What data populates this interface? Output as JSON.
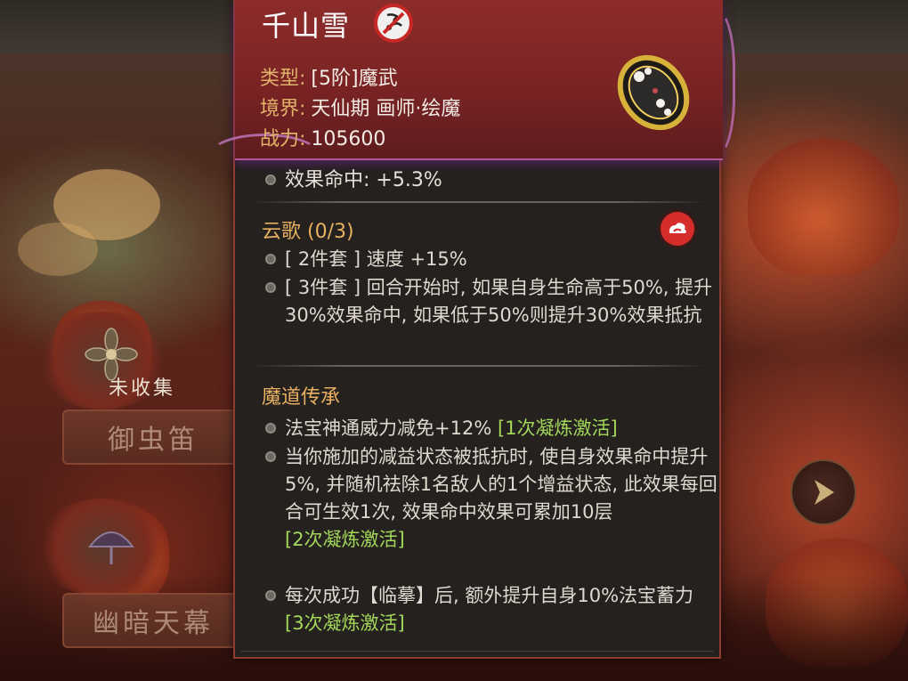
{
  "background": {
    "side_items": [
      {
        "name": "御虫笛",
        "status": "未收集"
      },
      {
        "name": "幽暗天幕",
        "status": ""
      }
    ]
  },
  "tooltip": {
    "name": "千山雪",
    "restriction_icon": "no-entry-icon",
    "type_label": "类型:",
    "type_value": "[5阶]魔武",
    "realm_label": "境界:",
    "realm_value": "天仙期 画师·绘魔",
    "power_label": "战力:",
    "power_value": "105600",
    "stat": "效果命中: +5.3%",
    "set": {
      "title": "云歌 (0/3)",
      "icon": "set-cloud-icon",
      "effects": [
        {
          "text": "[ 2件套 ] 速度 +15%"
        },
        {
          "text": "[ 3件套 ] 回合开始时, 如果自身生命高于50%, 提升30%效果命中, 如果低于50%则提升30%效果抵抗"
        }
      ]
    },
    "legacy": {
      "title": "魔道传承",
      "effects": [
        {
          "text": "法宝神通威力减免+12% ",
          "unlock": "[1次凝炼激活]"
        },
        {
          "text": "当你施加的减益状态被抵抗时, 使自身效果命中提升5%, 并随机祛除1名敌人的1个增益状态, 此效果每回合可生效1次, 效果命中效果可累加10层",
          "unlock": "[2次凝炼激活]"
        },
        {
          "text": "每次成功【临摹】后, 额外提升自身10%法宝蓄力 ",
          "unlock": "[3次凝炼激活]"
        }
      ]
    }
  },
  "colors": {
    "label_gold": "#e0b36a",
    "unlock_green": "#a3d85a",
    "header_red": "#8c2c2a",
    "panel_bg": "#24211f"
  }
}
